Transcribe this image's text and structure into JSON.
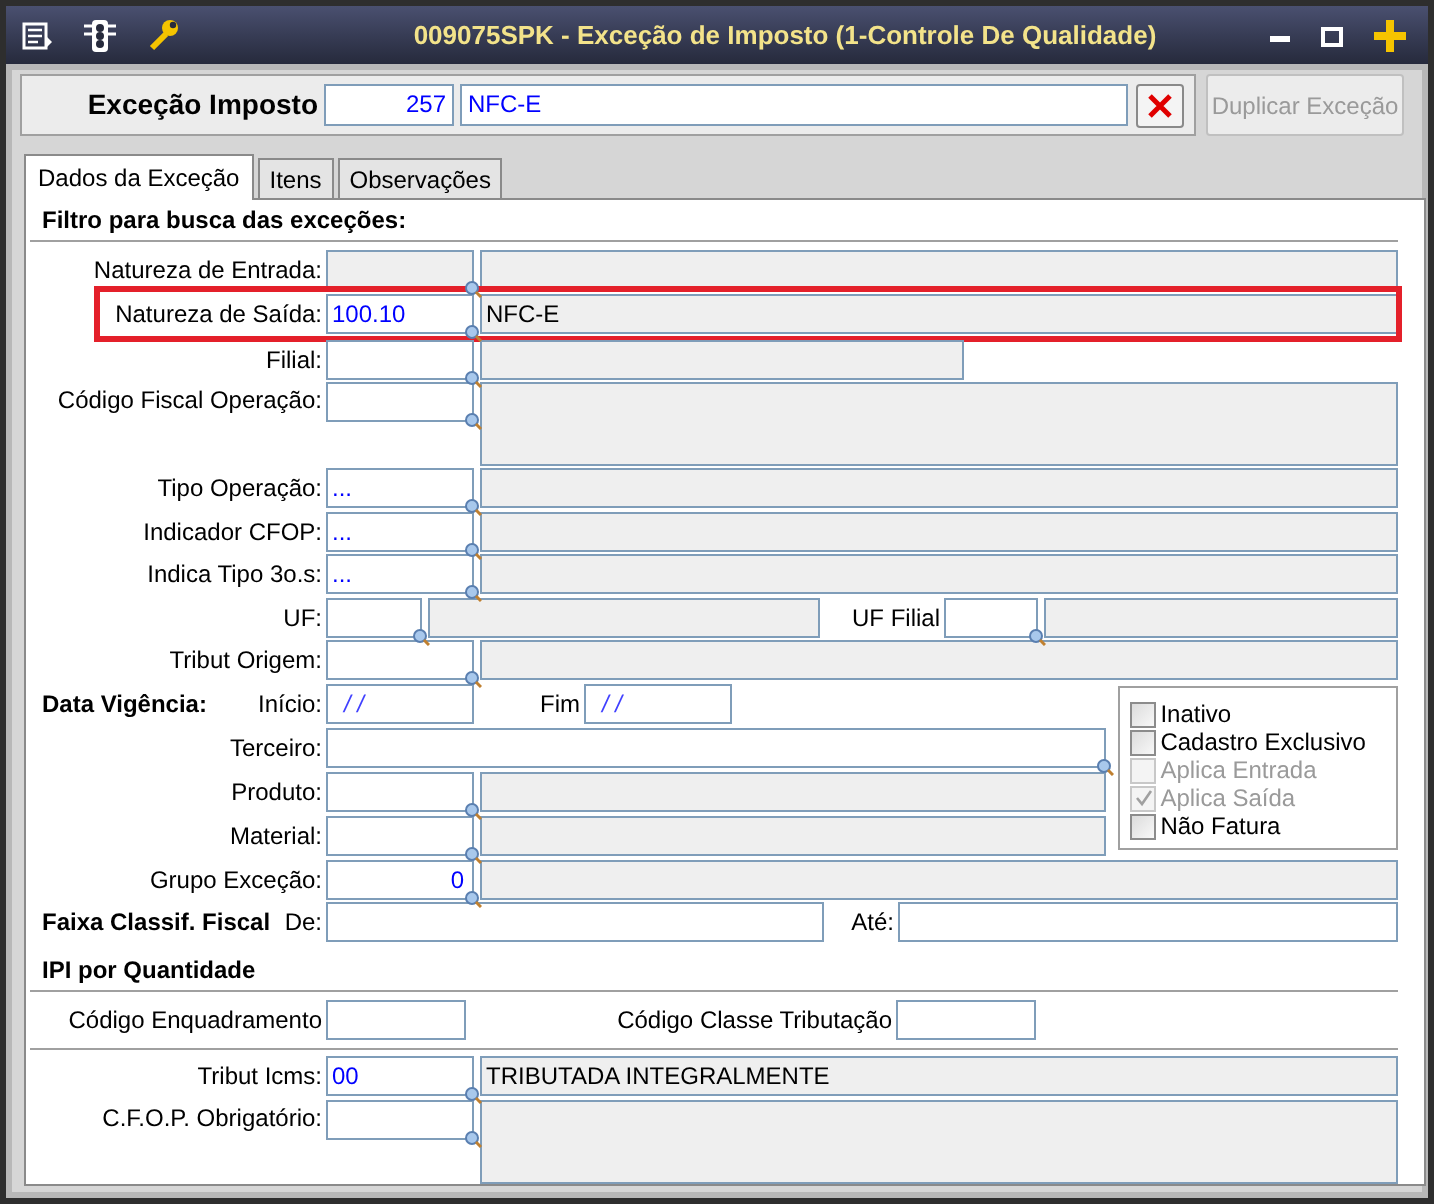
{
  "window": {
    "title": "009075SPK - Exceção de Imposto (1-Controle De Qualidade)"
  },
  "header": {
    "label": "Exceção Imposto",
    "code": "257",
    "description": "NFC-E",
    "duplicate_label": "Duplicar Exceção",
    "duplicate_disabled": true
  },
  "tabs": [
    {
      "label": "Dados da Exceção",
      "selected": true
    },
    {
      "label": "Itens",
      "selected": false
    },
    {
      "label": "Observações",
      "selected": false
    }
  ],
  "filter_title": "Filtro para busca das exceções:",
  "natureza_entrada": {
    "label": "Natureza de Entrada:",
    "disabled": true
  },
  "natureza_saida": {
    "label": "Natureza de Saída:",
    "code": "100.10",
    "description": "NFC-E",
    "highlighted": true
  },
  "filial": {
    "label": "Filial:"
  },
  "codigo_fiscal": {
    "label": "Código Fiscal Operação:"
  },
  "tipo_operacao": {
    "label": "Tipo Operação:",
    "code": "..."
  },
  "indicador_cfop": {
    "label": "Indicador CFOP:",
    "code": "..."
  },
  "indica_tipo": {
    "label": "Indica Tipo 3o.s:",
    "code": "..."
  },
  "uf": {
    "label": "UF:"
  },
  "uf_filial": {
    "label": "UF Filial"
  },
  "tribut_origem": {
    "label": "Tribut Origem:"
  },
  "data_vigencia": {
    "title": "Data Vigência:",
    "start_label": "Início:",
    "start": "/ /",
    "end_label": "Fim",
    "end": "/ /"
  },
  "terceiro": {
    "label": "Terceiro:"
  },
  "produto": {
    "label": "Produto:"
  },
  "material": {
    "label": "Material:"
  },
  "grupo_excecao": {
    "label": "Grupo Exceção:",
    "code": "0"
  },
  "options": [
    {
      "label": "Inativo",
      "checked": false,
      "disabled": false
    },
    {
      "label": "Cadastro Exclusivo",
      "checked": false,
      "disabled": false
    },
    {
      "label": "Aplica Entrada",
      "checked": false,
      "disabled": true
    },
    {
      "label": "Aplica Saída",
      "checked": true,
      "disabled": true
    },
    {
      "label": "Não Fatura",
      "checked": false,
      "disabled": false
    }
  ],
  "faixa": {
    "title": "Faixa Classif. Fiscal",
    "from_label": "De:",
    "to_label": "Até:"
  },
  "ipi_title": "IPI por Quantidade",
  "codigo_enquadramento": {
    "label": "Código Enquadramento"
  },
  "codigo_classe": {
    "label": "Código Classe Tributação"
  },
  "tribut_icms": {
    "label": "Tribut Icms:",
    "code": "00",
    "description": "TRIBUTADA INTEGRALMENTE"
  },
  "cfop_obrigatorio": {
    "label": "C.F.O.P. Obrigatório:"
  }
}
